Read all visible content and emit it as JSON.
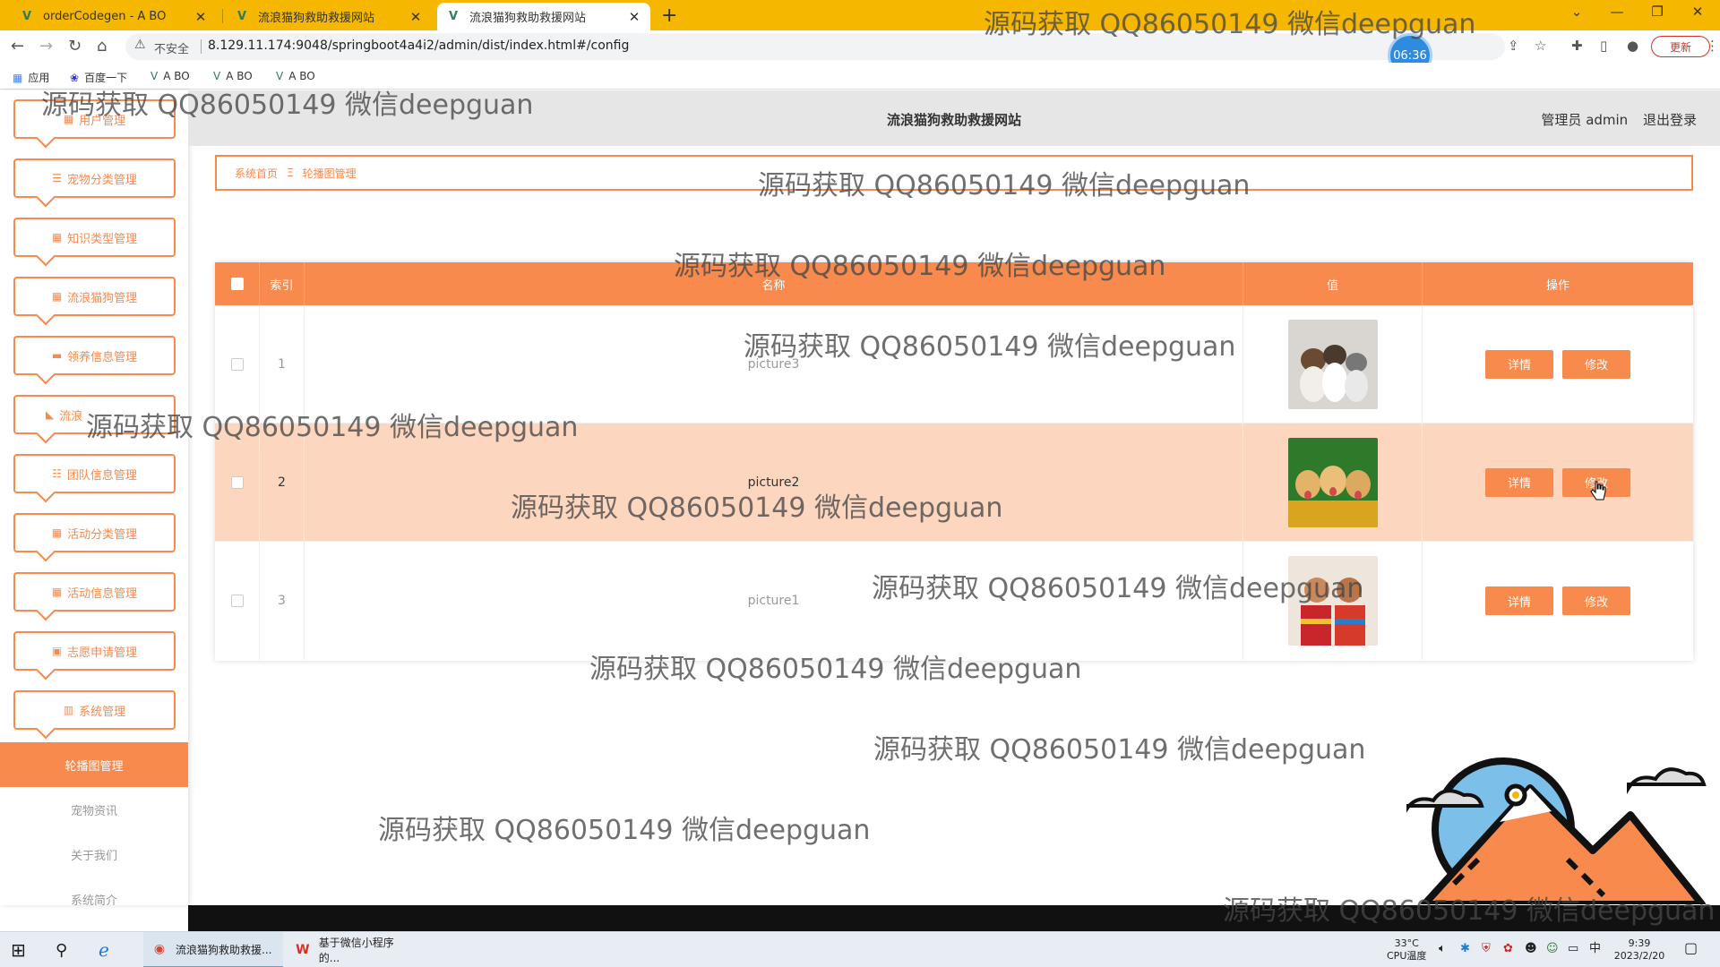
{
  "browser": {
    "tabs": [
      {
        "title": "orderCodegen - A BO",
        "favicon": "vue-logo"
      },
      {
        "title": "流浪猫狗救助救援网站",
        "favicon": "vue-logo"
      },
      {
        "title": "流浪猫狗救助救援网站",
        "favicon": "vue-logo",
        "active": true
      }
    ],
    "security_label": "不安全",
    "url": "8.129.11.174:9048/springboot4a4i2/admin/dist/index.html#/config",
    "update_label": "更新",
    "bookmarks": [
      {
        "label": "应用",
        "icon": "apps-grid-icon"
      },
      {
        "label": "百度一下",
        "icon": "baidu-paw-icon"
      },
      {
        "label": "A BO",
        "icon": "vue-logo"
      },
      {
        "label": "A BO",
        "icon": "vue-logo"
      },
      {
        "label": "A BO",
        "icon": "vue-logo"
      }
    ],
    "clock_badge": "06:36"
  },
  "sidebar": {
    "menu": [
      {
        "label": "用户管理",
        "icon": "grid-icon"
      },
      {
        "label": "宠物分类管理",
        "icon": "list-icon"
      },
      {
        "label": "知识类型管理",
        "icon": "grid-icon"
      },
      {
        "label": "流浪猫狗管理",
        "icon": "grid-icon"
      },
      {
        "label": "领养信息管理",
        "icon": "ticket-icon"
      },
      {
        "label": "流浪",
        "icon": "shoe-icon"
      },
      {
        "label": "团队信息管理",
        "icon": "sliders-icon"
      },
      {
        "label": "活动分类管理",
        "icon": "grid-icon"
      },
      {
        "label": "活动信息管理",
        "icon": "grid-icon"
      },
      {
        "label": "志愿申请管理",
        "icon": "clipboard-icon"
      },
      {
        "label": "系统管理",
        "icon": "bar-chart-icon"
      }
    ],
    "submenu": [
      {
        "label": "轮播图管理",
        "active": true
      },
      {
        "label": "宠物资讯"
      },
      {
        "label": "关于我们"
      },
      {
        "label": "系统简介"
      }
    ]
  },
  "header": {
    "title": "流浪猫狗救助救援网站",
    "admin": "管理员 admin",
    "logout": "退出登录"
  },
  "breadcrumb": {
    "home": "系统首页",
    "separator": "Ξ",
    "current": "轮播图管理"
  },
  "table": {
    "columns": [
      "索引",
      "名称",
      "值",
      "操作"
    ],
    "rows": [
      {
        "index": "1",
        "name": "picture3",
        "image": "puppy-and-kittens"
      },
      {
        "index": "2",
        "name": "picture2",
        "image": "golden-retriever-puppies",
        "highlight": true
      },
      {
        "index": "3",
        "name": "picture1",
        "image": "puppies-in-sweaters"
      }
    ],
    "detail_label": "详情",
    "edit_label": "修改"
  },
  "watermark": "源码获取 QQ86050149 微信deepguan",
  "taskbar": {
    "apps": [
      {
        "label": "流浪猫狗救助救援...",
        "icon": "chrome-icon"
      },
      {
        "label": "基于微信小程序的...",
        "icon": "wps-writer-icon"
      }
    ],
    "temperature": "33°C",
    "cpu_label": "CPU温度",
    "ime": "中",
    "time": "9:39",
    "date": "2023/2/20"
  },
  "colors": {
    "accent": "#f78a4c",
    "tabbar": "#f5b700",
    "highlight_row": "#fcd6bf",
    "header_bg": "#e6e6e6"
  }
}
